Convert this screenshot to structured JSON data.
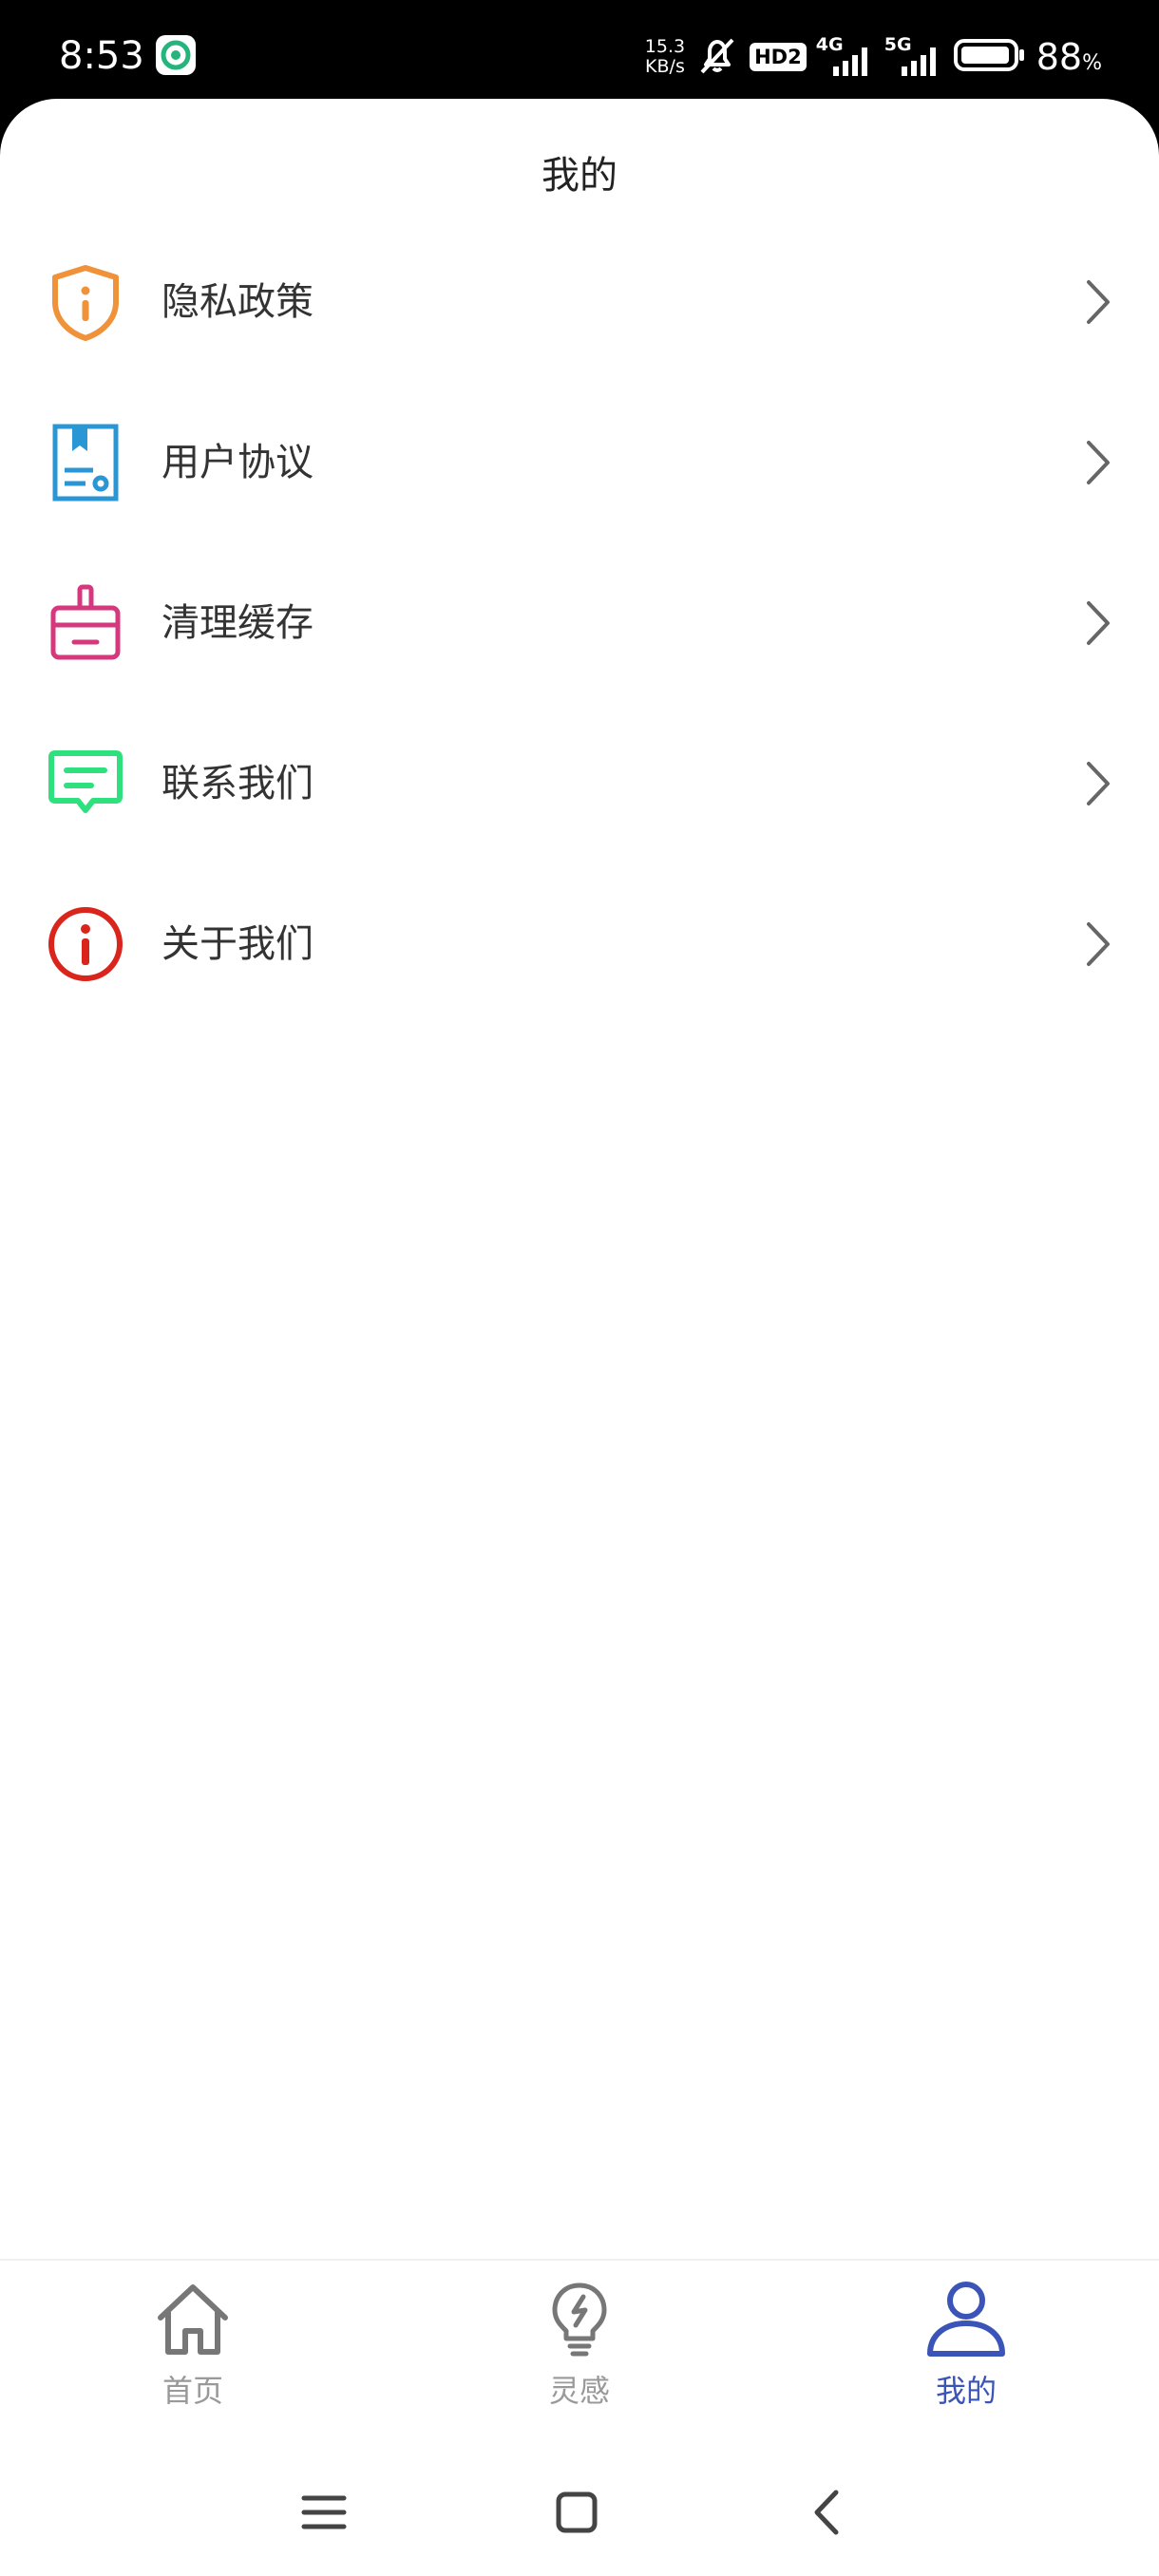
{
  "status": {
    "time": "8:53",
    "netspeed_value": "15.3",
    "netspeed_unit": "KB/s",
    "hd_badge": "HD2",
    "gen1": "4G",
    "gen2": "5G",
    "battery_value": "88",
    "battery_unit": "%",
    "icons": [
      "app-notification-icon",
      "silent-bell-icon",
      "signal-4g-icon",
      "signal-5g-icon",
      "battery-icon"
    ]
  },
  "page": {
    "title": "我的"
  },
  "menu": [
    {
      "label": "隐私政策",
      "icon": "privacy-shield-icon",
      "color": "#f0923a"
    },
    {
      "label": "用户协议",
      "icon": "user-agreement-icon",
      "color": "#2a97d4"
    },
    {
      "label": "清理缓存",
      "icon": "clear-cache-icon",
      "color": "#d6387d"
    },
    {
      "label": "联系我们",
      "icon": "contact-chat-icon",
      "color": "#2ee07e"
    },
    {
      "label": "关于我们",
      "icon": "about-info-icon",
      "color": "#d9251c"
    }
  ],
  "tabs": [
    {
      "label": "首页",
      "icon": "home-icon",
      "active": false
    },
    {
      "label": "灵感",
      "icon": "lightbulb-icon",
      "active": false
    },
    {
      "label": "我的",
      "icon": "person-icon",
      "active": true
    }
  ],
  "colors": {
    "active_tab": "#3b54b8",
    "inactive_tab": "#999999",
    "chevron": "#666666"
  }
}
